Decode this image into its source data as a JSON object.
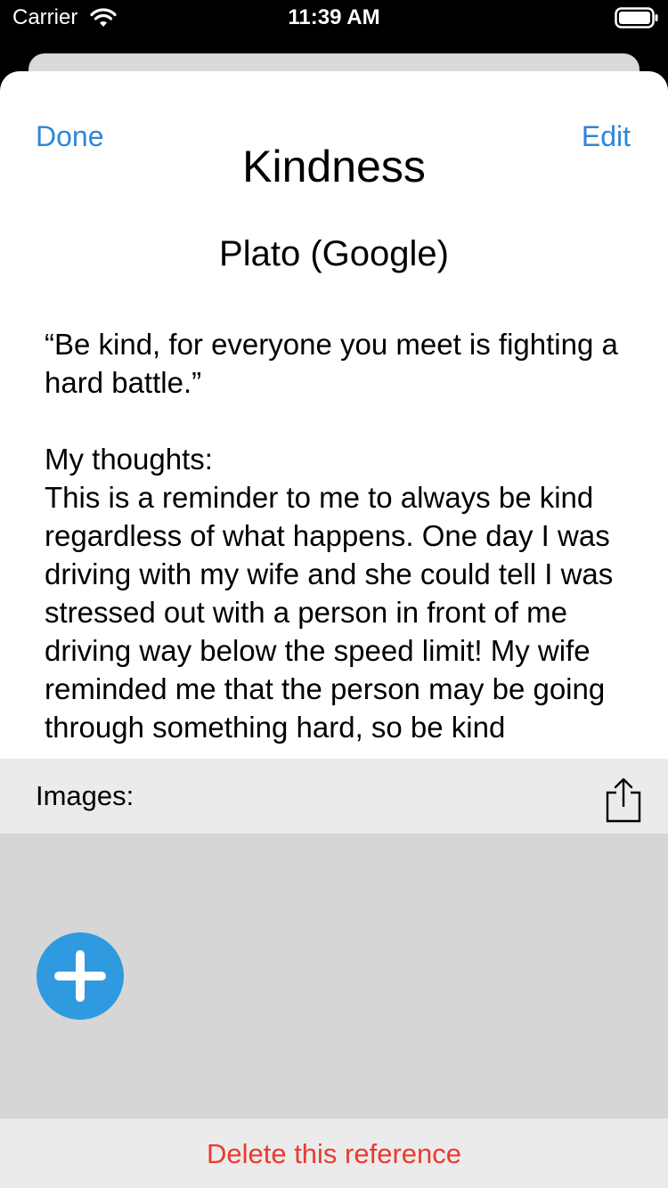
{
  "status_bar": {
    "carrier": "Carrier",
    "time": "11:39 AM",
    "icons": [
      "wifi-icon",
      "battery-icon"
    ]
  },
  "nav": {
    "done_label": "Done",
    "edit_label": "Edit"
  },
  "reference": {
    "title": "Kindness",
    "author": "Plato (Google)",
    "quote": "“Be kind, for everyone you meet is fighting a hard battle.”",
    "thoughts_heading": "My thoughts:",
    "thoughts_body": "This is a reminder to me to always be kind regardless of what happens. One day I was driving with my wife and she could tell I was stressed out with a person in front of me driving way below the speed limit! My wife reminded me that the person may be going through something hard, so be kind"
  },
  "images_section": {
    "label": "Images:",
    "share_icon": "share-icon",
    "add_icon": "plus-icon"
  },
  "footer": {
    "delete_label": "Delete this reference"
  },
  "colors": {
    "accent": "#2f86d8",
    "add_button": "#2f9ae0",
    "destructive": "#ea3a2f",
    "bar_background": "#ebebeb",
    "images_background": "#d6d6d6"
  }
}
